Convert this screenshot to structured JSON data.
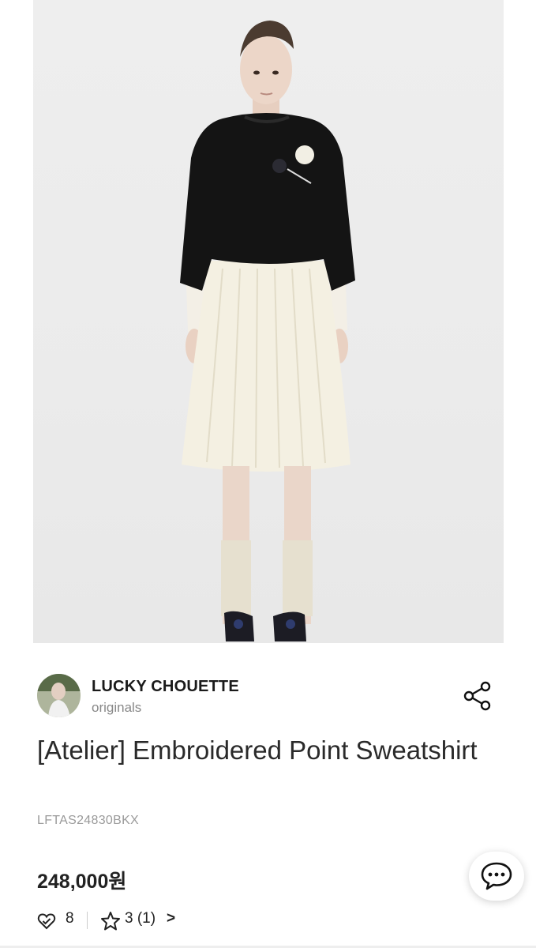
{
  "product": {
    "image_alt": "Model wearing black embroidered sweatshirt with white pleated skirt",
    "brand": {
      "name": "LUCKY CHOUETTE",
      "sub_label": "originals"
    },
    "title": "[Atelier] Embroidered Point Sweatshirt",
    "sku": "LFTAS24830BKX",
    "price": "248,000원",
    "stats": {
      "likes": "8",
      "rating_text": "3 (1)",
      "chevron": ">"
    }
  },
  "icons": {
    "share": "share-icon",
    "chat": "chat-icon",
    "like": "heart-check-icon",
    "star": "star-icon"
  },
  "colors": {
    "sweatshirt": "#141414",
    "skirt": "#f4f0e2",
    "background": "#ececec"
  }
}
